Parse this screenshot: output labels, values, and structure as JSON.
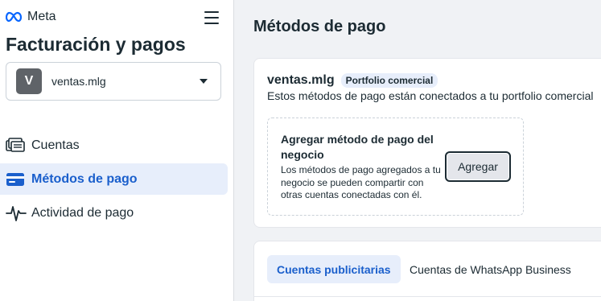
{
  "brand": {
    "logo_text": "Meta"
  },
  "sidebar": {
    "title": "Facturación y pagos",
    "account": {
      "avatar_letter": "V",
      "name": "ventas.mlg"
    },
    "items": [
      {
        "label": "Cuentas",
        "icon": "accounts-stack-icon",
        "active": false
      },
      {
        "label": "Métodos de pago",
        "icon": "credit-card-icon",
        "active": true
      },
      {
        "label": "Actividad de pago",
        "icon": "activity-pulse-icon",
        "active": false
      }
    ]
  },
  "main": {
    "title": "Métodos de pago",
    "portfolio": {
      "name": "ventas.mlg",
      "badge": "Portfolio comercial",
      "description": "Estos métodos de pago están conectados a tu portfolio comercial"
    },
    "add_payment": {
      "title": "Agregar método de pago del negocio",
      "description": "Los métodos de pago agregados a tu negocio se pueden compartir con otras cuentas conectadas con él.",
      "button_label": "Agregar"
    },
    "tabs": [
      {
        "label": "Cuentas publicitarias",
        "active": true
      },
      {
        "label": "Cuentas de WhatsApp Business",
        "active": false
      }
    ]
  },
  "colors": {
    "accent": "#1a5fcc",
    "active_bg": "#e7eefb",
    "page_bg": "#f0f2f5",
    "text": "#1c2b33"
  }
}
